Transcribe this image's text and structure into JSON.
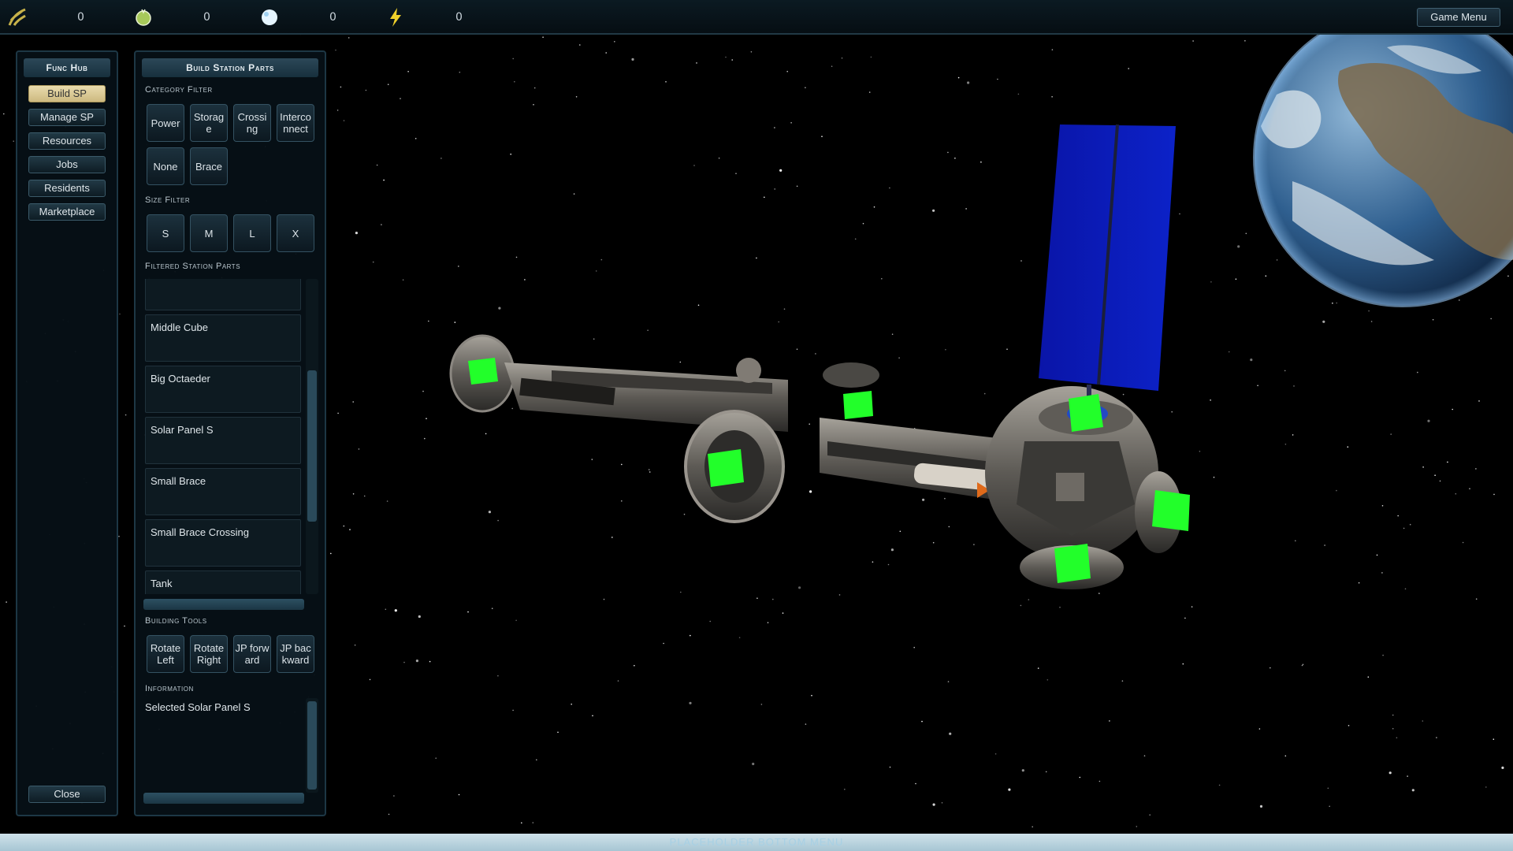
{
  "resources": [
    {
      "icon": "biomass-icon",
      "value": "0",
      "color": "#c7b24a"
    },
    {
      "icon": "food-icon",
      "value": "0",
      "color": "#b9d86a"
    },
    {
      "icon": "water-icon",
      "value": "0",
      "color": "#dff2ff"
    },
    {
      "icon": "energy-icon",
      "value": "0",
      "color": "#f0d12a"
    }
  ],
  "topbar": {
    "game_menu_label": "Game Menu"
  },
  "func_hub": {
    "title": "Func Hub",
    "items": [
      "Build SP",
      "Manage SP",
      "Resources",
      "Jobs",
      "Residents",
      "Marketplace"
    ],
    "active_index": 0,
    "close_label": "Close"
  },
  "build_panel": {
    "title": "Build Station Parts",
    "category_filter_label": "Category Filter",
    "categories": [
      "Power",
      "Storage",
      "Crossing",
      "Interconnect",
      "None",
      "Brace"
    ],
    "size_filter_label": "Size Filter",
    "sizes": [
      "S",
      "M",
      "L",
      "X"
    ],
    "filtered_label": "Filtered Station Parts",
    "parts": [
      "",
      "Middle Cube",
      "Big Octaeder",
      "Solar Panel S",
      "Small Brace",
      "Small Brace Crossing",
      "Tank"
    ],
    "building_tools_label": "Building Tools",
    "tools": [
      "Rotate Left",
      "Rotate Right",
      "JP forward",
      "JP backward"
    ],
    "information_label": "Information",
    "information_text": "Selected Solar Panel S"
  },
  "bottom_bar": {
    "label": "PLACEHOLDER BOTTOM MENU"
  },
  "colors": {
    "accent_active": "#e2d39f",
    "panel_border": "#1d3745",
    "socket_green": "#22ff2a",
    "solar_blue": "#0a18b8"
  }
}
